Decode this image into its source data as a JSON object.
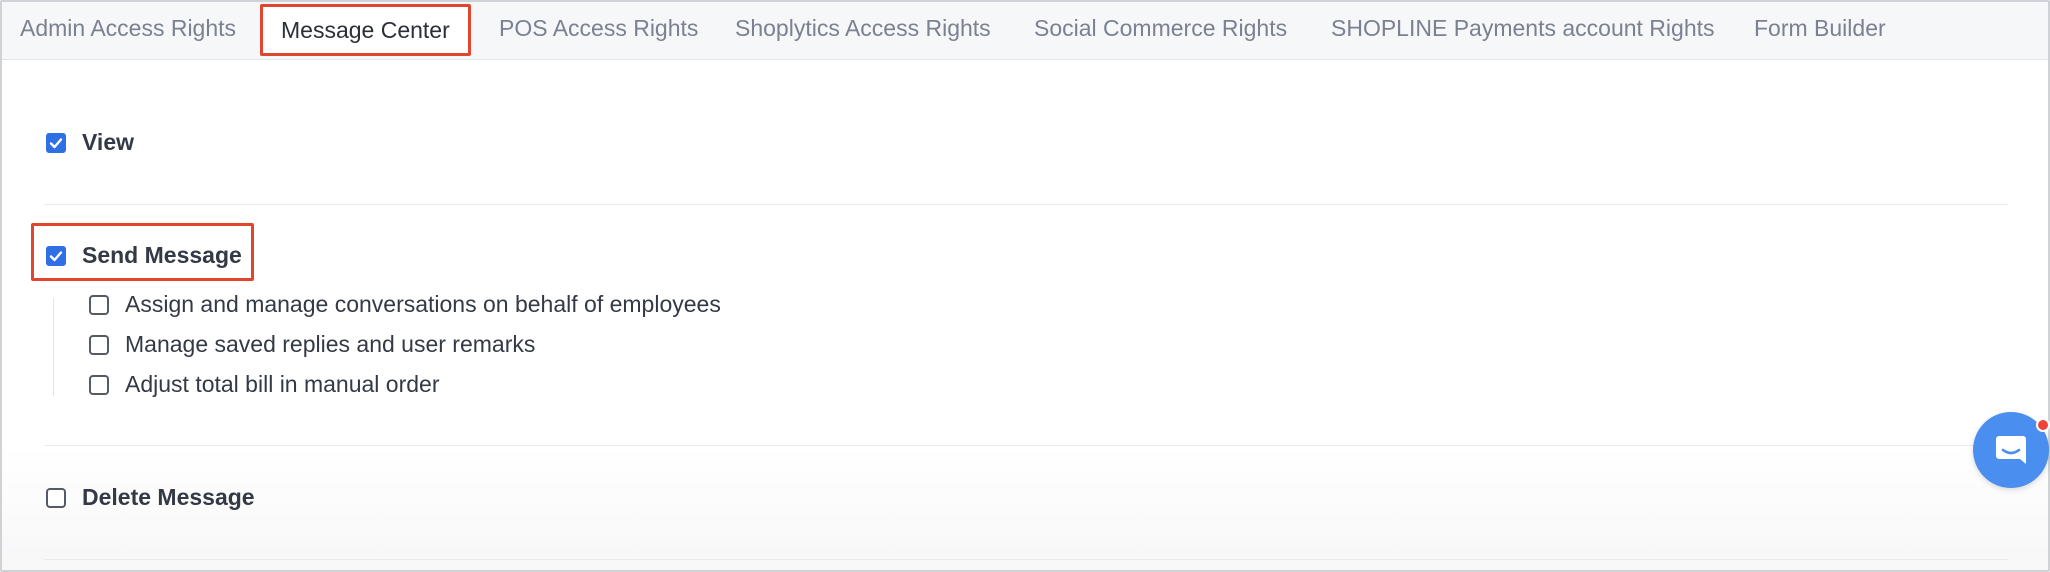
{
  "tabs": [
    {
      "label": "Admin Access Rights",
      "active": false
    },
    {
      "label": "Message Center",
      "active": true
    },
    {
      "label": "POS Access Rights",
      "active": false
    },
    {
      "label": "Shoplytics Access Rights",
      "active": false
    },
    {
      "label": "Social Commerce Rights",
      "active": false
    },
    {
      "label": "SHOPLINE Payments account Rights",
      "active": false
    },
    {
      "label": "Form Builder",
      "active": false
    }
  ],
  "permissions": {
    "view": {
      "label": "View",
      "checked": true
    },
    "send_message": {
      "label": "Send Message",
      "checked": true,
      "sub_items": [
        {
          "label": "Assign and manage conversations on behalf of employees",
          "checked": false
        },
        {
          "label": "Manage saved replies and user remarks",
          "checked": false
        },
        {
          "label": "Adjust total bill in manual order",
          "checked": false
        }
      ]
    },
    "delete_message": {
      "label": "Delete Message",
      "checked": false
    }
  },
  "colors": {
    "accent_blue": "#2f6fe4",
    "highlight_red": "#e0452d",
    "chat_blue": "#4a8ef0",
    "notification_red": "#f0443a"
  },
  "icons": {
    "check": "check-icon",
    "chat": "chat-bubble-icon"
  }
}
